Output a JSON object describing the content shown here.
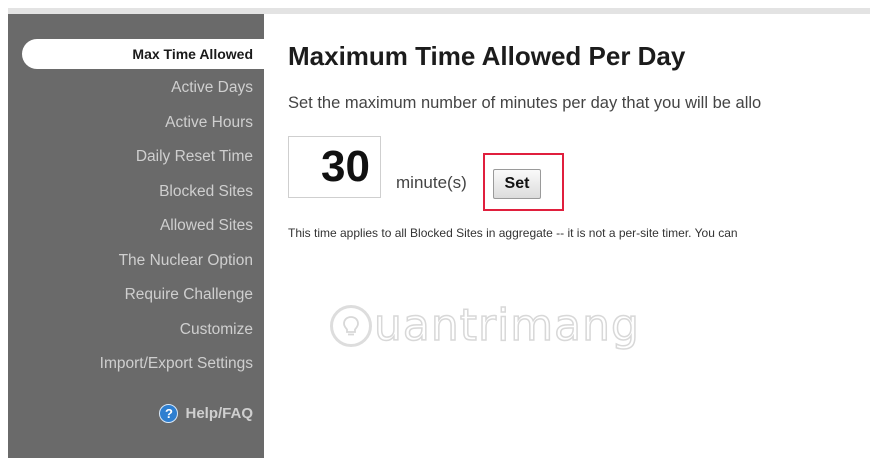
{
  "sidebar": {
    "items": [
      {
        "label": "Max Time Allowed",
        "active": true
      },
      {
        "label": "Active Days"
      },
      {
        "label": "Active Hours"
      },
      {
        "label": "Daily Reset Time"
      },
      {
        "label": "Blocked Sites"
      },
      {
        "label": "Allowed Sites"
      },
      {
        "label": "The Nuclear Option"
      },
      {
        "label": "Require Challenge"
      },
      {
        "label": "Customize"
      },
      {
        "label": "Import/Export Settings"
      }
    ],
    "help": {
      "icon": "help-circle-icon",
      "icon_glyph": "?",
      "label": "Help/FAQ"
    }
  },
  "main": {
    "title": "Maximum Time Allowed Per Day",
    "description": "Set the maximum number of minutes per day that you will be allo",
    "minutes_value": "30",
    "unit_label": "minute(s)",
    "set_label": "Set",
    "note": "This time applies to all Blocked Sites in aggregate -- it is not a per-site timer. You can"
  },
  "watermark": {
    "text": "uantrimang",
    "icon": "lightbulb-icon"
  },
  "colors": {
    "sidebar_bg": "#6a6a6a",
    "sidebar_text": "#cfcfcf",
    "highlight_border": "#e01f3d",
    "help_icon": "#2f7fd0"
  }
}
